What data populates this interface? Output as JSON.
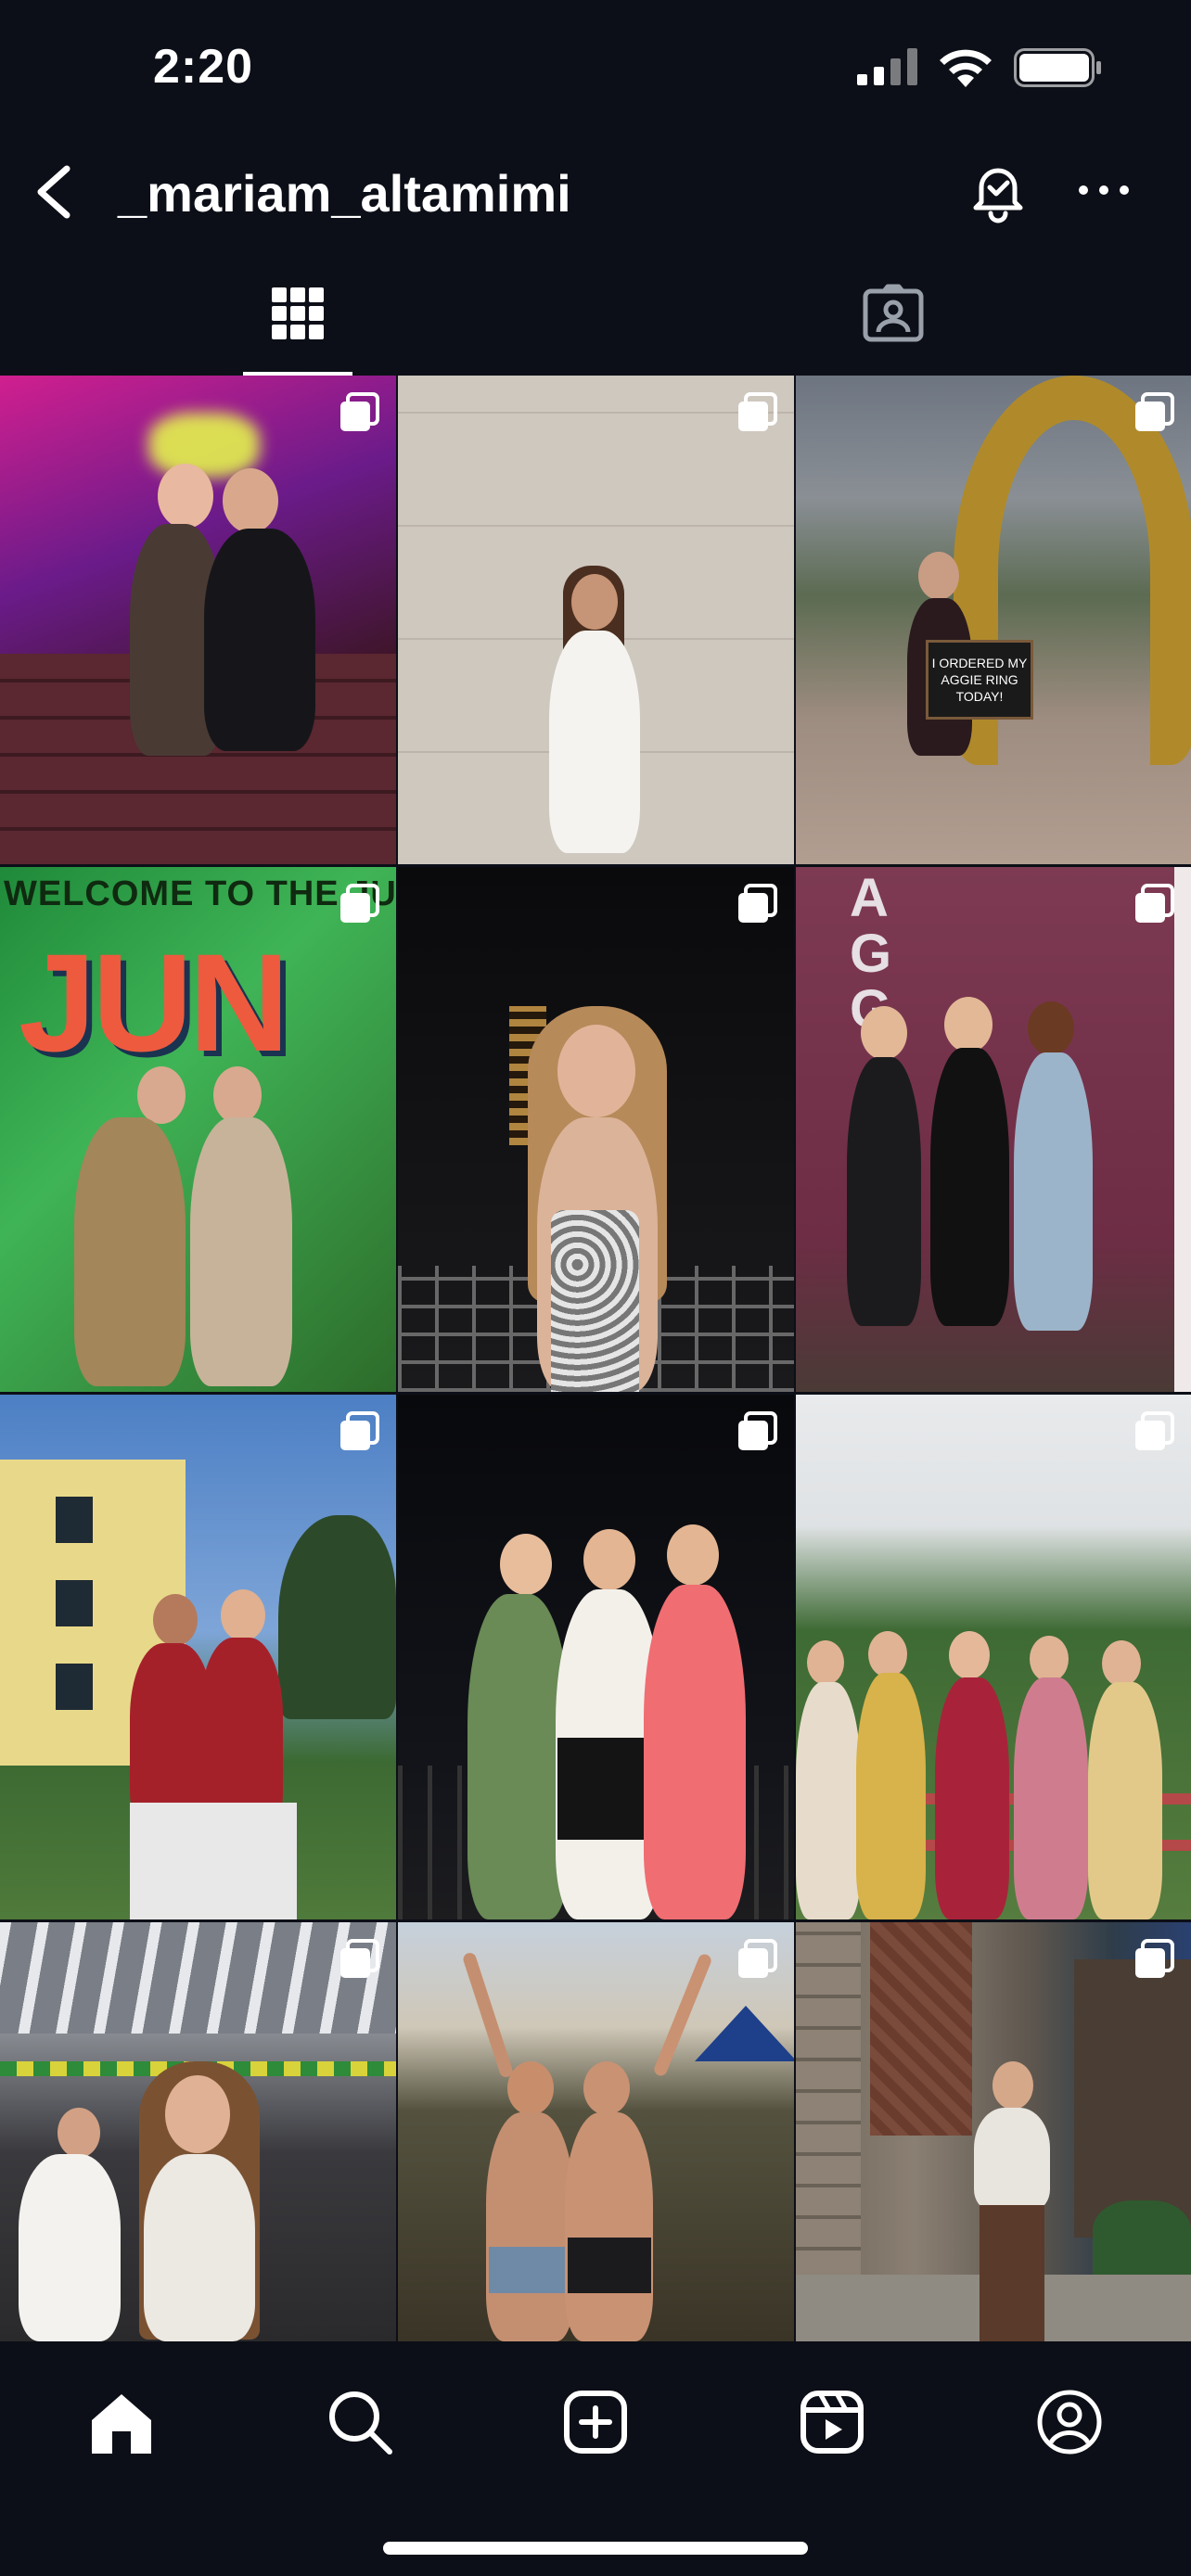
{
  "status_bar": {
    "time": "2:20"
  },
  "header": {
    "username": "_mariam_altamimi"
  },
  "tabs": [
    {
      "name": "posts-grid",
      "active": true
    },
    {
      "name": "tagged",
      "active": false
    }
  ],
  "posts": [
    {
      "id": 1,
      "multiple": true,
      "scene": "neon-wall-night",
      "text": ""
    },
    {
      "id": 2,
      "multiple": true,
      "scene": "marble-wall-white-dress",
      "text": ""
    },
    {
      "id": 3,
      "multiple": true,
      "scene": "aggie-ring-sculpture",
      "text": "I ORDERED MY AGGIE RING TODAY!"
    },
    {
      "id": 4,
      "multiple": true,
      "scene": "jungle-banner",
      "text": "WELCOME TO THE JUN"
    },
    {
      "id": 5,
      "multiple": true,
      "scene": "night-balcony",
      "text": ""
    },
    {
      "id": 6,
      "multiple": true,
      "scene": "maroon-banner-group",
      "text": "A G G"
    },
    {
      "id": 7,
      "multiple": true,
      "scene": "yellow-house-sunset",
      "text": ""
    },
    {
      "id": 8,
      "multiple": true,
      "scene": "night-trio",
      "text": ""
    },
    {
      "id": 9,
      "multiple": true,
      "scene": "park-group-fence",
      "text": ""
    },
    {
      "id": 10,
      "multiple": true,
      "scene": "pavilion-party",
      "text": ""
    },
    {
      "id": 11,
      "multiple": true,
      "scene": "festival-sunset",
      "text": ""
    },
    {
      "id": 12,
      "multiple": true,
      "scene": "stone-building",
      "text": ""
    }
  ],
  "bottom_nav": [
    "home",
    "search",
    "create",
    "reels",
    "profile"
  ],
  "colors": {
    "background": "#0c0f17",
    "foreground": "#ffffff",
    "maroon": "#7a3044"
  }
}
